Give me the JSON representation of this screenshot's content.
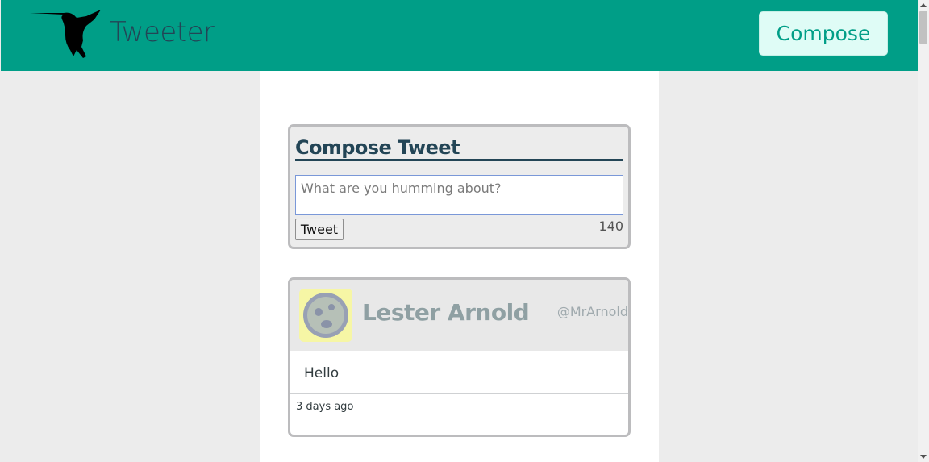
{
  "navbar": {
    "brand": "Tweeter",
    "logo_icon": "hummingbird-icon",
    "compose_label": "Compose"
  },
  "compose": {
    "title": "Compose Tweet",
    "placeholder": "What are you humming about?",
    "value": "",
    "submit_label": "Tweet",
    "char_count": "140"
  },
  "tweets": [
    {
      "avatar_icon": "avatar-icon",
      "name": "Lester Arnold",
      "handle": "@MrArnold",
      "text": "Hello",
      "timestamp": "3 days ago"
    }
  ],
  "colors": {
    "primary": "#009e87",
    "navy": "#234556",
    "compose_button_bg": "#dffcf6"
  }
}
